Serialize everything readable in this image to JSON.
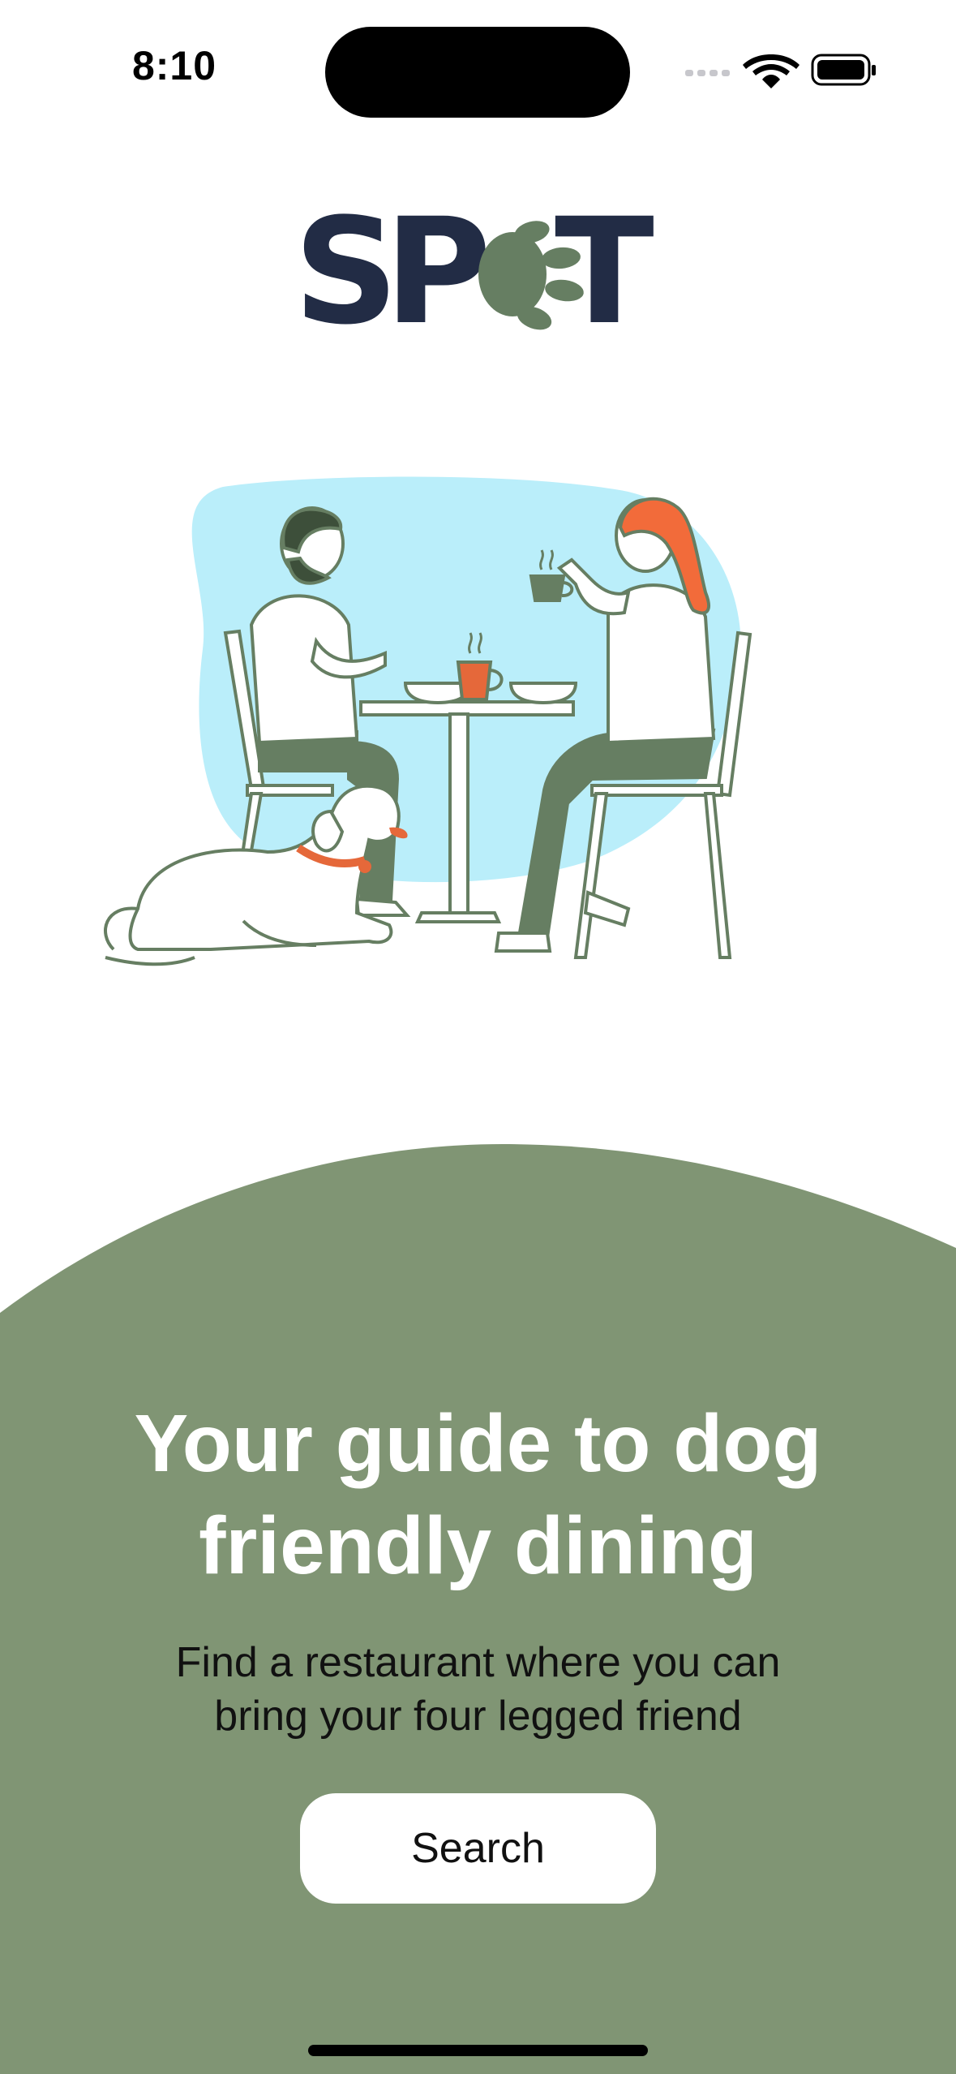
{
  "status_bar": {
    "time": "8:10",
    "icons": [
      "cellular-signal-icon",
      "wifi-icon",
      "battery-icon"
    ]
  },
  "logo": {
    "text": "SPOT",
    "letters": [
      "S",
      "P",
      "T"
    ],
    "paw_icon": "paw-print-icon",
    "text_color": "#222c45",
    "paw_color": "#667e62"
  },
  "illustration": {
    "subject": "couple-dining-with-dog",
    "colors": {
      "backdrop": "#baeefa",
      "green": "#667e62",
      "orange": "#e5683a",
      "hair": "#f26b3a"
    }
  },
  "hero": {
    "headline_line1": "Your guide to dog",
    "headline_line2": "friendly dining",
    "subtitle_line1": "Find a restaurant where you can",
    "subtitle_line2": "bring your four legged friend"
  },
  "actions": {
    "search_label": "Search"
  },
  "colors": {
    "green_panel": "#809574",
    "button_bg": "#ffffff",
    "headline": "#ffffff"
  }
}
